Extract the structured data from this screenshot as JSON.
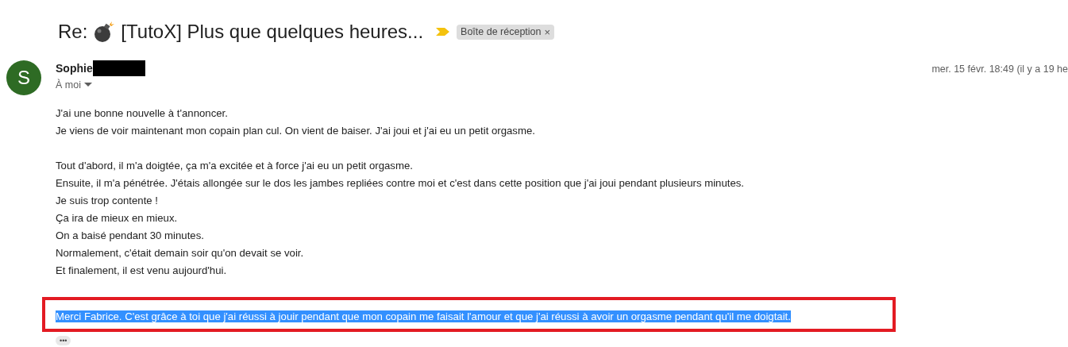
{
  "subject": {
    "prefix": "Re:",
    "text": "[TutoX] Plus que quelques heures...",
    "important": true,
    "label": "Boîte de réception",
    "label_close": "×"
  },
  "message": {
    "avatar_letter": "S",
    "sender": "Sophie",
    "sender_redacted": true,
    "recipient": "À moi",
    "date": "mer. 15 févr. 18:49 (il y a 19 he",
    "paragraphs": [
      [
        "J'ai une bonne nouvelle à t'annoncer.",
        "Je viens de voir maintenant mon copain plan cul. On vient de baiser. J'ai joui et j'ai eu un petit orgasme."
      ],
      [
        "Tout d'abord, il m'a doigtée, ça m'a excitée et à force j'ai eu un petit orgasme.",
        "Ensuite, il m'a pénétrée. J'étais allongée sur le dos les jambes repliées contre moi et c'est dans cette position que j'ai joui pendant plusieurs minutes.",
        "Je suis trop contente !",
        "Ça ira de mieux en mieux.",
        "On a baisé pendant 30 minutes.",
        "Normalement, c'était demain soir qu'on devait se voir.",
        "Et finalement, il est venu aujourd'hui."
      ]
    ],
    "highlighted_paragraph": {
      "text": "Merci Fabrice. C'est grâce à toi que j'ai réussi à jouir pendant que mon copain me faisait l'amour et que j'ai réussi à avoir un orgasme pendant qu'il me doigtait.",
      "selected": true,
      "framed": true
    },
    "more_button": "•••"
  }
}
